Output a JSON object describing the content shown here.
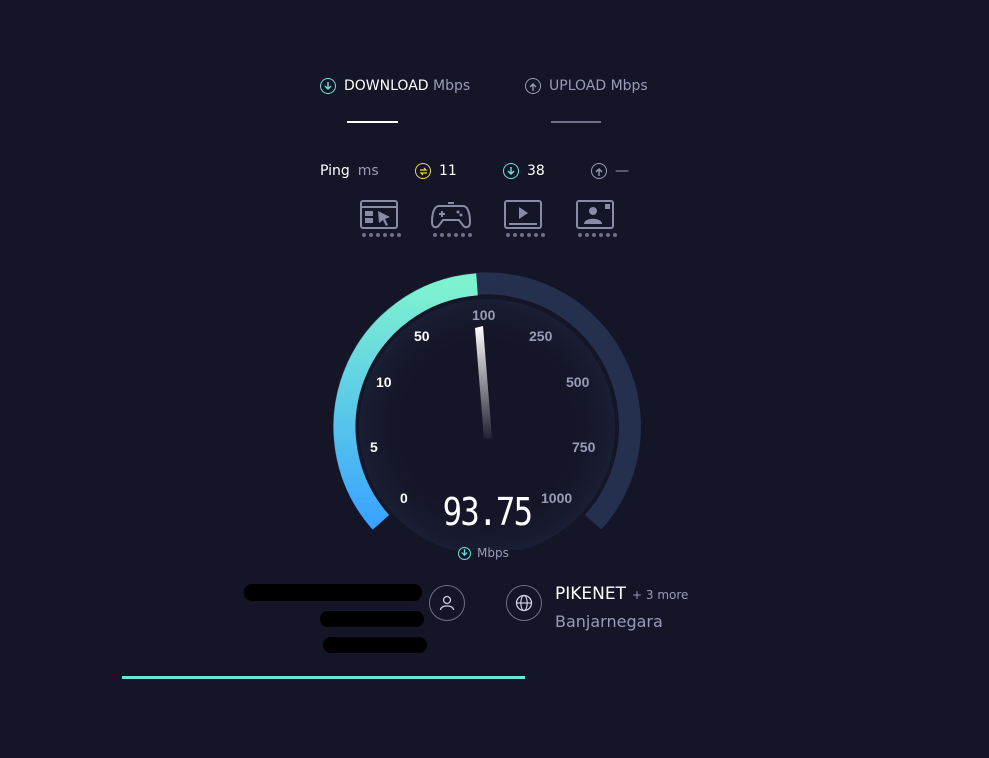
{
  "tabs": {
    "download": {
      "label": "DOWNLOAD",
      "unit": "Mbps"
    },
    "upload": {
      "label": "UPLOAD",
      "unit": "Mbps"
    }
  },
  "ping": {
    "label": "Ping",
    "unit": "ms",
    "idle": "11",
    "download": "38",
    "upload": "—"
  },
  "activities": [
    {
      "icon": "web-browsing-icon"
    },
    {
      "icon": "gaming-icon"
    },
    {
      "icon": "video-streaming-icon"
    },
    {
      "icon": "video-call-icon"
    }
  ],
  "gauge": {
    "ticks": [
      "0",
      "5",
      "10",
      "50",
      "100",
      "250",
      "500",
      "750",
      "1000"
    ],
    "value": "93.75",
    "unit": "Mbps"
  },
  "isp": {
    "name": "PIKENET",
    "more": "+ 3 more",
    "location": "Banjarnegara"
  },
  "progress": 0.53,
  "colors": {
    "background": "#141526",
    "accent_cyan": "#6fe3d9",
    "gauge_fill_start": "#3aa3ff",
    "gauge_fill_end": "#7ef2cf",
    "gauge_track": "#25304f",
    "ping_idle": "#f2d65c"
  }
}
